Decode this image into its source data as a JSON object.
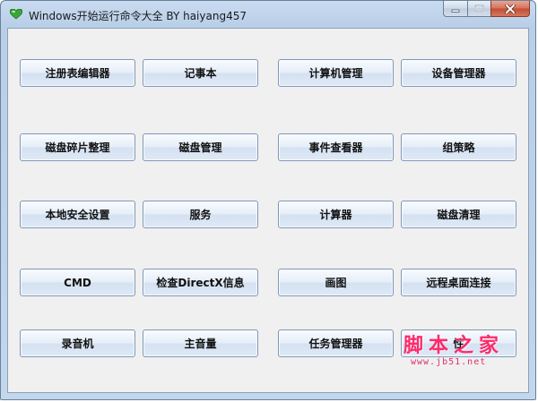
{
  "window": {
    "title": "Windows开始运行命令大全 BY haiyang457",
    "icon": "green-heart-icon"
  },
  "caption": {
    "minimize_icon": "minimize-icon",
    "maximize_icon": "maximize-icon",
    "close_icon": "close-icon"
  },
  "rows": [
    [
      "注册表编辑器",
      "记事本",
      "计算机管理",
      "设备管理器"
    ],
    [
      "磁盘碎片整理",
      "磁盘管理",
      "事件查看器",
      "组策略"
    ],
    [
      "本地安全设置",
      "服务",
      "计算器",
      "磁盘清理"
    ],
    [
      "CMD",
      "检查DirectX信息",
      "画图",
      "远程桌面连接"
    ],
    [
      "录音机",
      "主音量",
      "任务管理器",
      "性"
    ]
  ],
  "watermark": {
    "line1": "脚本之家",
    "line2": "www.jb51.net"
  },
  "colors": {
    "frame": "#b9cfe8",
    "client": "#f0f0f0",
    "button_border": "#7f98b9",
    "close": "#c24d34",
    "watermark": "#ff2a6a"
  }
}
